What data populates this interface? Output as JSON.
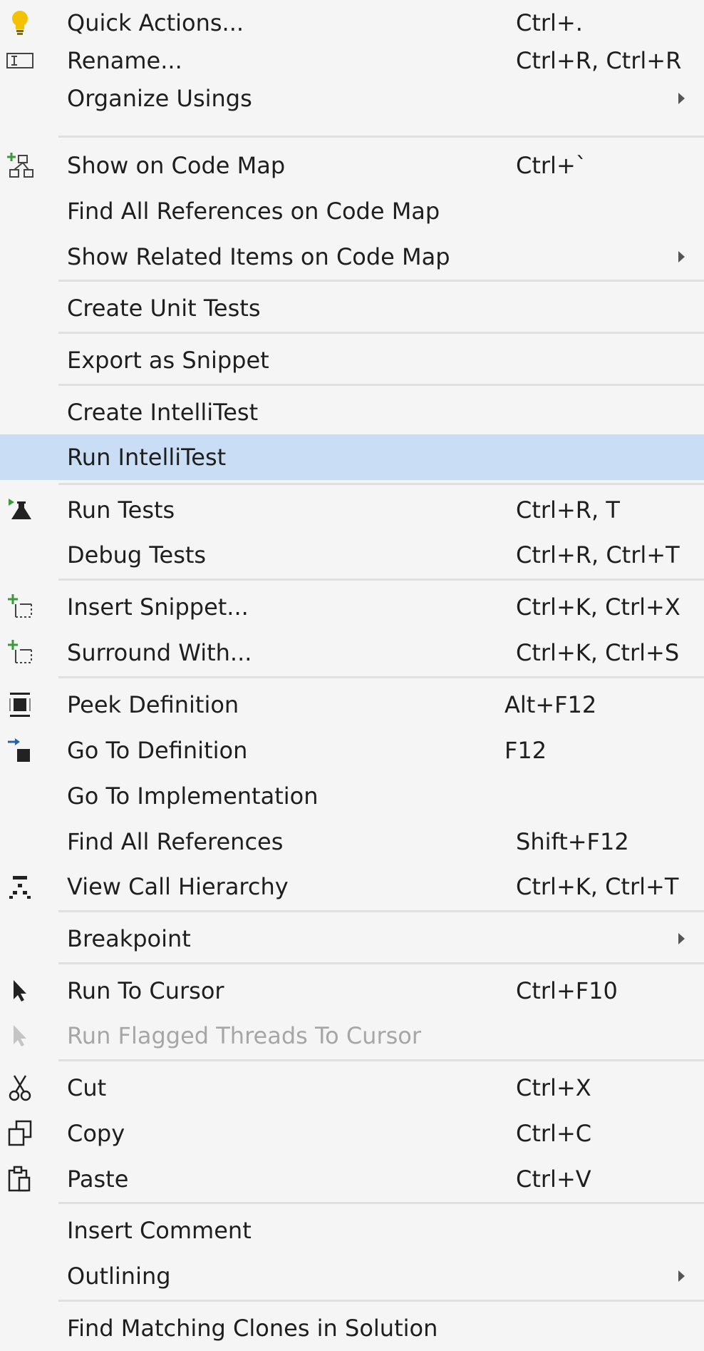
{
  "menu": {
    "items": [
      {
        "label": "Quick Actions...",
        "shortcut": "Ctrl+.",
        "icon": "lightbulb-icon"
      },
      {
        "label": "Rename...",
        "shortcut": "Ctrl+R, Ctrl+R",
        "icon": "rename-icon"
      },
      {
        "label": "Organize Usings",
        "shortcut": "",
        "submenu": true
      },
      {
        "label": "Show on Code Map",
        "shortcut": "Ctrl+`",
        "icon": "code-map-icon"
      },
      {
        "label": "Find All References on Code Map",
        "shortcut": ""
      },
      {
        "label": "Show Related Items on Code Map",
        "shortcut": "",
        "submenu": true
      },
      {
        "label": "Create Unit Tests",
        "shortcut": ""
      },
      {
        "label": "Export as Snippet",
        "shortcut": ""
      },
      {
        "label": "Create IntelliTest",
        "shortcut": ""
      },
      {
        "label": "Run IntelliTest",
        "shortcut": "",
        "highlighted": true
      },
      {
        "label": "Run Tests",
        "shortcut": "Ctrl+R, T",
        "icon": "run-tests-icon"
      },
      {
        "label": "Debug Tests",
        "shortcut": "Ctrl+R, Ctrl+T"
      },
      {
        "label": "Insert Snippet...",
        "shortcut": "Ctrl+K, Ctrl+X",
        "icon": "insert-snippet-icon"
      },
      {
        "label": "Surround With...",
        "shortcut": "Ctrl+K, Ctrl+S",
        "icon": "surround-with-icon"
      },
      {
        "label": "Peek Definition",
        "shortcut": "Alt+F12",
        "icon": "peek-definition-icon"
      },
      {
        "label": "Go To Definition",
        "shortcut": "F12",
        "icon": "go-to-definition-icon"
      },
      {
        "label": "Go To Implementation",
        "shortcut": ""
      },
      {
        "label": "Find All References",
        "shortcut": "Shift+F12"
      },
      {
        "label": "View Call Hierarchy",
        "shortcut": "Ctrl+K, Ctrl+T",
        "icon": "call-hierarchy-icon"
      },
      {
        "label": "Breakpoint",
        "shortcut": "",
        "submenu": true
      },
      {
        "label": "Run To Cursor",
        "shortcut": "Ctrl+F10",
        "icon": "cursor-icon"
      },
      {
        "label": "Run Flagged Threads To Cursor",
        "shortcut": "",
        "disabled": true,
        "icon": "cursor-disabled-icon"
      },
      {
        "label": "Cut",
        "shortcut": "Ctrl+X",
        "icon": "scissors-icon"
      },
      {
        "label": "Copy",
        "shortcut": "Ctrl+C",
        "icon": "copy-icon"
      },
      {
        "label": "Paste",
        "shortcut": "Ctrl+V",
        "icon": "paste-icon"
      },
      {
        "label": "Insert Comment",
        "shortcut": ""
      },
      {
        "label": "Outlining",
        "shortcut": "",
        "submenu": true
      },
      {
        "label": "Find Matching Clones in Solution",
        "shortcut": ""
      }
    ]
  },
  "colors": {
    "background": "#f5f5f5",
    "highlight": "#c9def5",
    "text": "#1e1e1e",
    "disabled_text": "#a6a6a6",
    "separator": "#e0e0e0"
  }
}
